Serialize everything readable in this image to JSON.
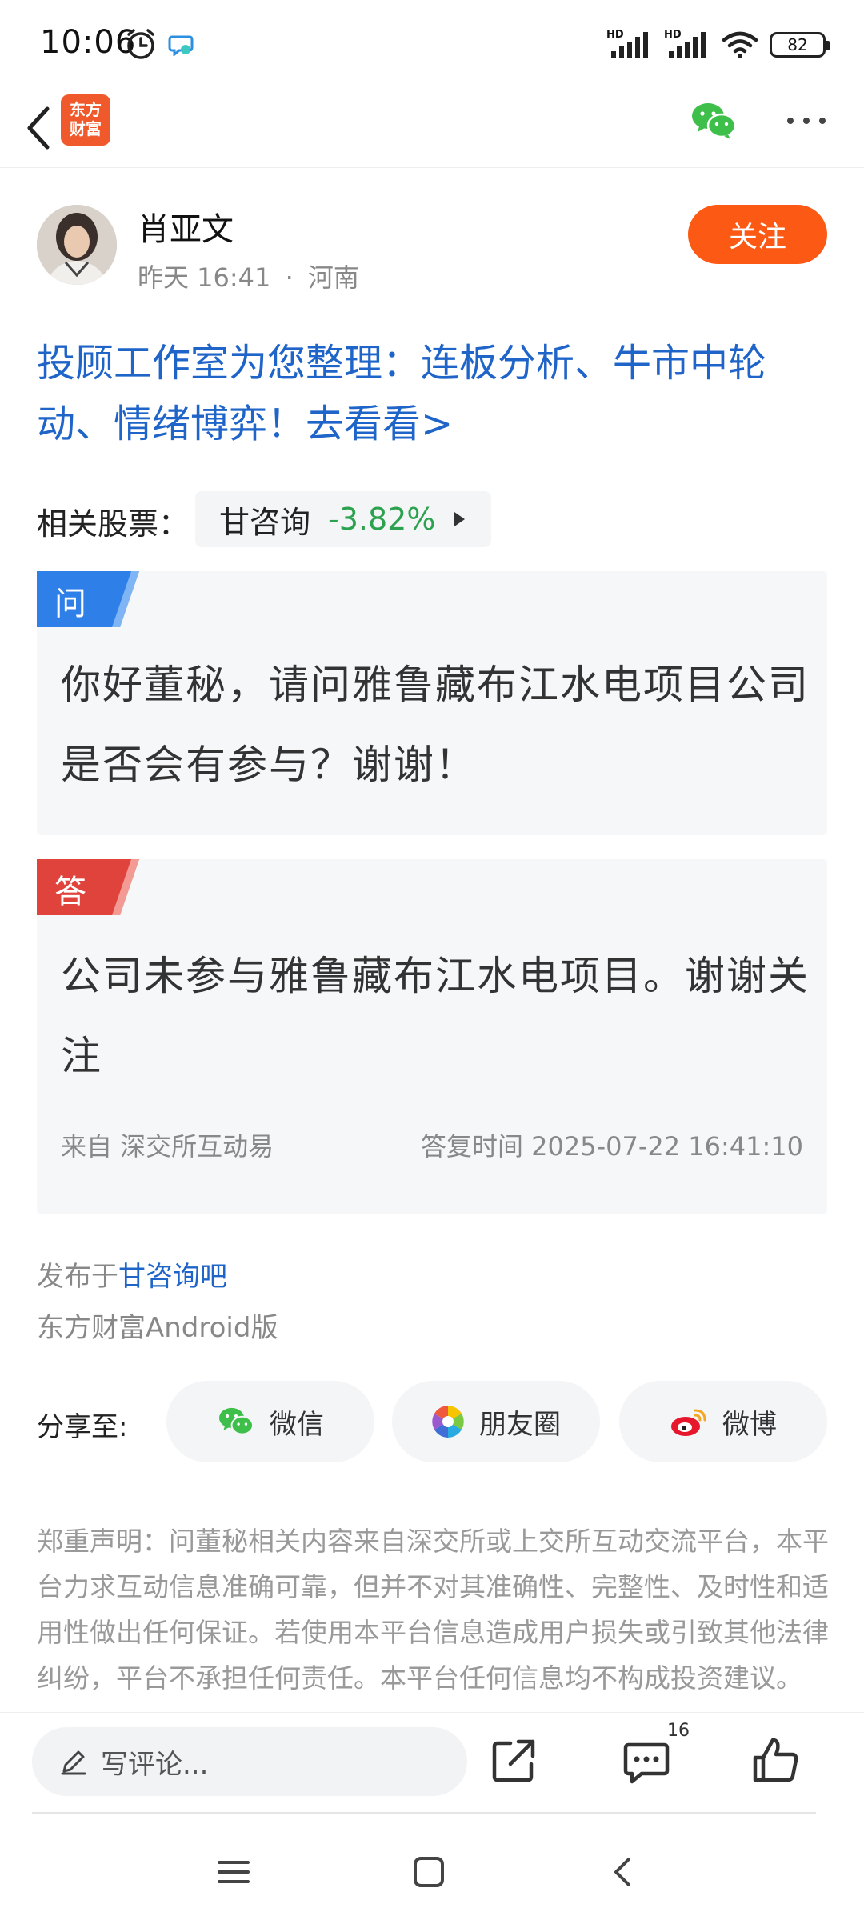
{
  "status_bar": {
    "time": "10:06",
    "battery": "82",
    "signal_label_1": "HD",
    "signal_label_2": "HD"
  },
  "topnav": {
    "app_logo_line1": "东方",
    "app_logo_line2": "财富"
  },
  "author": {
    "name": "肖亚文",
    "time": "昨天 16:41",
    "separator": "·",
    "location": "河南",
    "follow_label": "关注"
  },
  "headline": "投顾工作室为您整理：连板分析、牛市中轮动、情绪博弈！去看看>",
  "related_stock": {
    "label": "相关股票：",
    "name": "甘咨询",
    "change": "-3.82%"
  },
  "question": {
    "tag": "问",
    "text": "你好董秘，请问雅鲁藏布江水电项目公司是否会有参与？谢谢！"
  },
  "answer": {
    "tag": "答",
    "text": "公司未参与雅鲁藏布江水电项目。谢谢关注",
    "source": "来自 深交所互动易",
    "reply_time": "答复时间 2025-07-22 16:41:10"
  },
  "publish": {
    "prefix": "发布于",
    "bar_name": "甘咨询吧",
    "client": "东方财富Android版"
  },
  "share": {
    "label": "分享至:",
    "wechat": "微信",
    "moments": "朋友圈",
    "weibo": "微博"
  },
  "disclaimer": "郑重声明：问董秘相关内容来自深交所或上交所互动交流平台，本平台力求互动信息准确可靠，但并不对其准确性、完整性、及时性和适用性做出任何保证。若使用本平台信息造成用户损失或引致其他法律纠纷，平台不承担任何责任。本平台任何信息均不构成投资建议。",
  "bottom_bar": {
    "comment_placeholder": "写评论...",
    "comment_count": "16"
  },
  "colors": {
    "accent_orange": "#fc5a14",
    "link_blue": "#1f64c8",
    "stock_down_green": "#2ca24f",
    "question_tag": "#2f7fe8",
    "answer_tag": "#e0433b"
  },
  "icons": [
    "back-icon",
    "alarm-icon",
    "chat-bubble-icon",
    "wechat-icon",
    "more-icon",
    "moments-icon",
    "weibo-icon",
    "pencil-icon",
    "share-out-icon",
    "comment-icon",
    "thumbs-up-icon",
    "menu-icon",
    "home-icon",
    "back-nav-icon"
  ]
}
